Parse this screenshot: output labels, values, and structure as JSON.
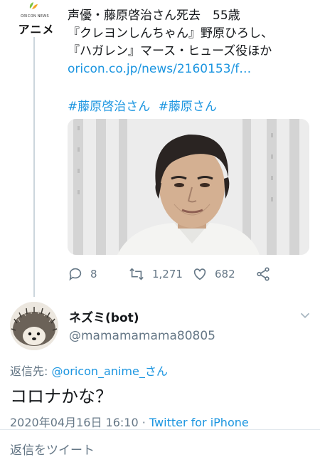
{
  "colors": {
    "link": "#1b95e0",
    "muted": "#657786",
    "text": "#14171a"
  },
  "parent_tweet": {
    "account_logo": {
      "small_text": "ORICON NEWS",
      "big_text": "アニメ"
    },
    "lines": [
      "声優・藤原啓治さん死去　55歳",
      "『クレヨンしんちゃん』野原ひろし、",
      "『ハガレン』マース・ヒューズ役ほか"
    ],
    "link": "oricon.co.jp/news/2160153/f…",
    "hashtags": [
      "#藤原啓治さん",
      "#藤原さん"
    ],
    "actions": {
      "reply_icon": "reply-icon",
      "reply_count": "8",
      "retweet_icon": "retweet-icon",
      "retweet_count": "1,271",
      "like_icon": "heart-icon",
      "like_count": "682",
      "share_icon": "share-icon"
    }
  },
  "reply_tweet": {
    "display_name": "ネズミ(bot)",
    "handle": "@mamamamama80805",
    "reply_to_label": "返信先: ",
    "reply_to_handle": "@oricon_anime_さん",
    "text": "コロナかな？",
    "date": "2020年04月16日 16:10",
    "separator": " · ",
    "source": "Twitter for iPhone"
  },
  "reply_bar": {
    "placeholder": "返信をツイート"
  }
}
